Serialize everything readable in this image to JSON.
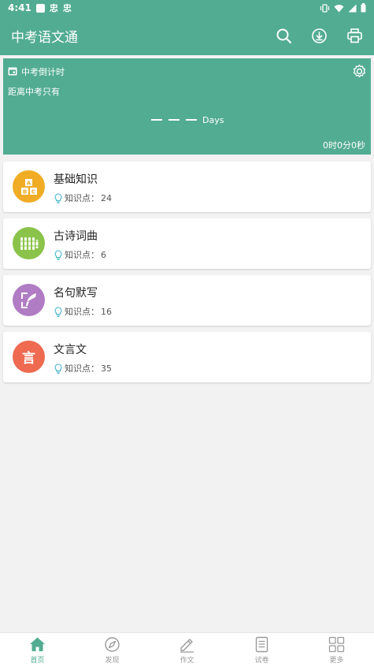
{
  "status_bar": {
    "time": "4:41",
    "glyph_1": "忠",
    "glyph_2": "忠"
  },
  "app_bar": {
    "title": "中考语文通",
    "actions": [
      "search-icon",
      "download-icon",
      "print-icon"
    ]
  },
  "countdown": {
    "header": "中考倒计时",
    "subtitle": "距离中考只有",
    "days_label": "Days",
    "time_remaining": "0时0分0秒"
  },
  "categories": [
    {
      "title": "基础知识",
      "meta_label": "知识点：",
      "count": "24",
      "icon": "abc-blocks-icon",
      "color": "#f0ac24"
    },
    {
      "title": "古诗词曲",
      "meta_label": "知识点：",
      "count": "6",
      "icon": "bamboo-scroll-icon",
      "color": "#8bc34a"
    },
    {
      "title": "名句默写",
      "meta_label": "知识点：",
      "count": "16",
      "icon": "quill-icon",
      "color": "#b07cc3"
    },
    {
      "title": "文言文",
      "meta_label": "知识点：",
      "count": "35",
      "icon": "yan-character-icon",
      "color": "#ee6a50",
      "icon_char": "言"
    }
  ],
  "bottom_nav": [
    {
      "label": "首页",
      "icon": "home-icon",
      "active": true
    },
    {
      "label": "发现",
      "icon": "compass-icon",
      "active": false
    },
    {
      "label": "作文",
      "icon": "pencil-icon",
      "active": false
    },
    {
      "label": "试卷",
      "icon": "document-icon",
      "active": false
    },
    {
      "label": "更多",
      "icon": "grid-icon",
      "active": false
    }
  ],
  "colors": {
    "primary": "#52ac91",
    "background": "#f2f2f2",
    "nav_inactive": "#9a9a9a"
  }
}
